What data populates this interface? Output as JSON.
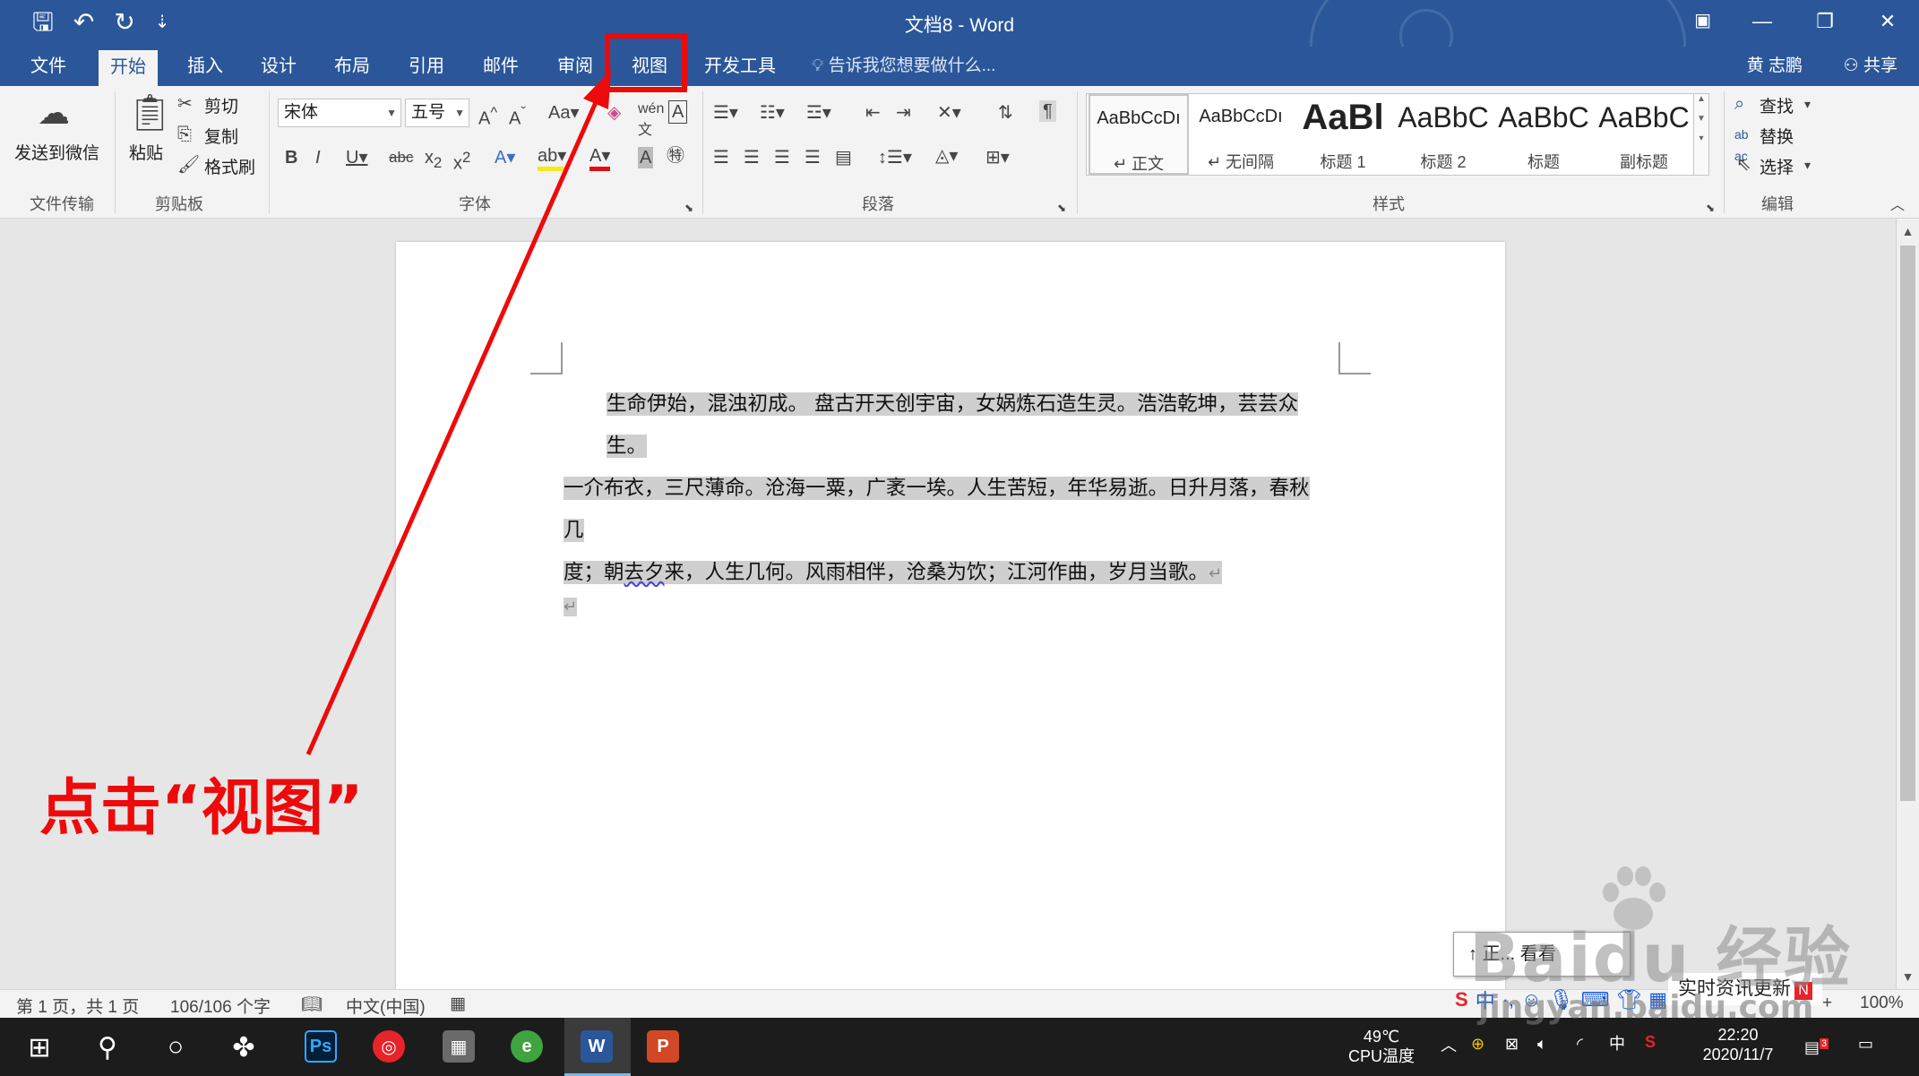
{
  "window": {
    "title": "文档8 - Word",
    "user": "黄 志鹏",
    "share": "共享",
    "tell_me": "告诉我您想要做什么..."
  },
  "qat": {
    "save": "🖫",
    "undo": "↶",
    "redo": "↻",
    "customize": "⇣"
  },
  "tabs": [
    {
      "label": "文件"
    },
    {
      "label": "开始"
    },
    {
      "label": "插入"
    },
    {
      "label": "设计"
    },
    {
      "label": "布局"
    },
    {
      "label": "引用"
    },
    {
      "label": "邮件"
    },
    {
      "label": "审阅"
    },
    {
      "label": "视图"
    },
    {
      "label": "开发工具"
    }
  ],
  "ribbon": {
    "wechat": {
      "label": "发送到微信",
      "group": "文件传输"
    },
    "clipboard": {
      "paste": "粘贴",
      "cut": "剪切",
      "copy": "复制",
      "format_painter": "格式刷",
      "group": "剪贴板"
    },
    "font": {
      "name": "宋体",
      "size": "五号",
      "group": "字体"
    },
    "paragraph": {
      "group": "段落"
    },
    "styles": {
      "group": "样式",
      "items": [
        {
          "sample": "AaBbCcDı",
          "name": "↵ 正文"
        },
        {
          "sample": "AaBbCcDı",
          "name": "↵ 无间隔"
        },
        {
          "sample": "AaBl",
          "name": "标题 1"
        },
        {
          "sample": "AaBbC",
          "name": "标题 2"
        },
        {
          "sample": "AaBbC",
          "name": "标题"
        },
        {
          "sample": "AaBbC",
          "name": "副标题"
        }
      ]
    },
    "editing": {
      "find": "查找",
      "replace": "替换",
      "select": "选择",
      "group": "编辑"
    }
  },
  "document": {
    "line1": "生命伊始，混浊初成。 盘古开天创宇宙，女娲炼石造生灵。浩浩乾坤，芸芸众生。",
    "line2": "一介布衣，三尺薄命。沧海一粟，广袤一埃。人生苦短，年华易逝。日升月落，春秋几",
    "line3_a": "度；朝",
    "line3_b": "去夕",
    "line3_c": "来，人生几何。风雨相伴，沧桑为饮；江河作曲，岁月当歌。",
    "para_mark": "↵"
  },
  "status": {
    "page": "第 1 页，共 1 页",
    "words": "106/106 个字",
    "language": "中文(中国)",
    "zoom": "100%",
    "zoom_plus": "+"
  },
  "taskbar": {
    "cpu_temp": "49℃",
    "cpu_label": "CPU温度",
    "time": "22:20",
    "date": "2020/11/7",
    "ime": "中",
    "notif_count": "3"
  },
  "overlays": {
    "popup_kanh": "↑ 正... 看看",
    "news": "实时资讯更新",
    "news_badge": "N",
    "watermark": "Baidu 经验",
    "watermark_url": "jingyan.baidu.com"
  },
  "annotation": {
    "text": "点击“视图”",
    "color": "#ee0a0a"
  },
  "colors": {
    "word_blue": "#2b579a",
    "ribbon_bg": "#f3f3f3",
    "selection": "#cfcfcf"
  }
}
